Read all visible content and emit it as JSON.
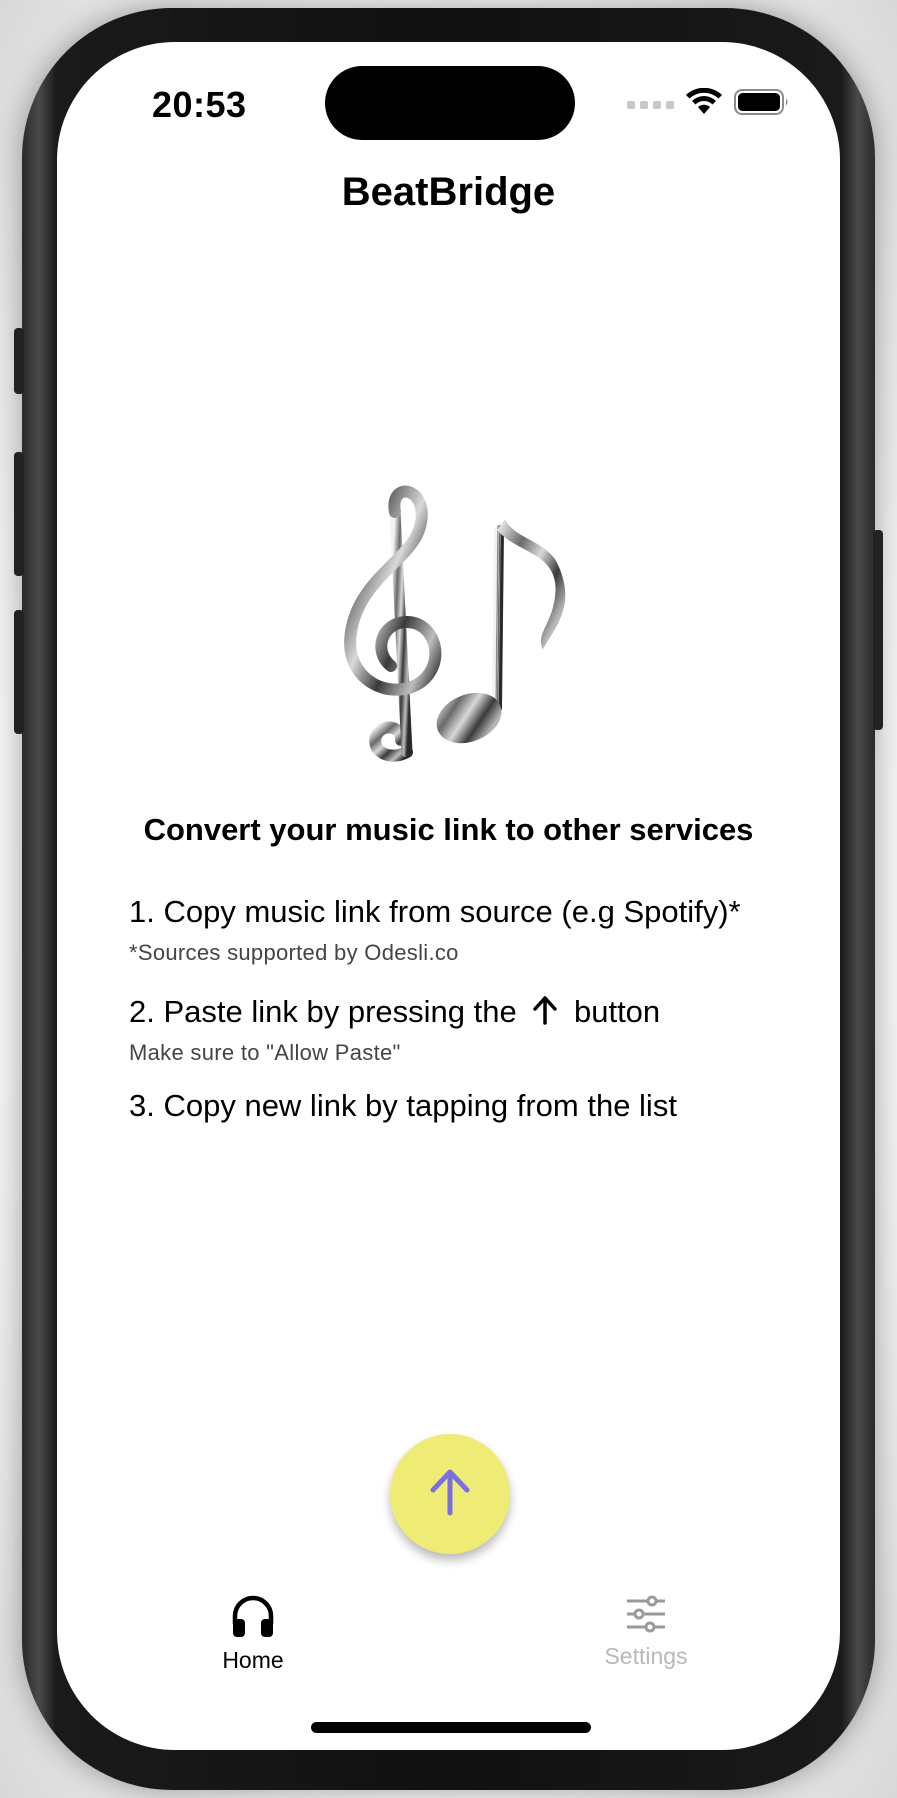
{
  "status_bar": {
    "time": "20:53",
    "icons": [
      "cellular-signal-icon",
      "wifi-icon",
      "battery-icon"
    ]
  },
  "app": {
    "title": "BeatBridge"
  },
  "hero": {
    "icon": "music-notes-icon"
  },
  "instructions": {
    "headline": "Convert your music link to other services",
    "step1": "1. Copy music link from source (e.g Spotify)*",
    "step1_note": "*Sources supported by Odesli.co",
    "step2_before": "2. Paste link by pressing the",
    "step2_icon": "arrow-up-icon",
    "step2_after": "button",
    "step2_note": "Make sure to \"Allow Paste\"",
    "step3": "3. Copy new link by tapping from the list"
  },
  "paste_button": {
    "icon": "arrow-up-icon",
    "color": "#eeec74",
    "icon_color": "#7b6fe0"
  },
  "tab_bar": {
    "tabs": [
      {
        "label": "Home",
        "icon": "headphones-icon",
        "active": true
      },
      {
        "label": "Settings",
        "icon": "sliders-icon",
        "active": false
      }
    ],
    "active_color": "#000000",
    "inactive_color": "#b8b8b8"
  }
}
